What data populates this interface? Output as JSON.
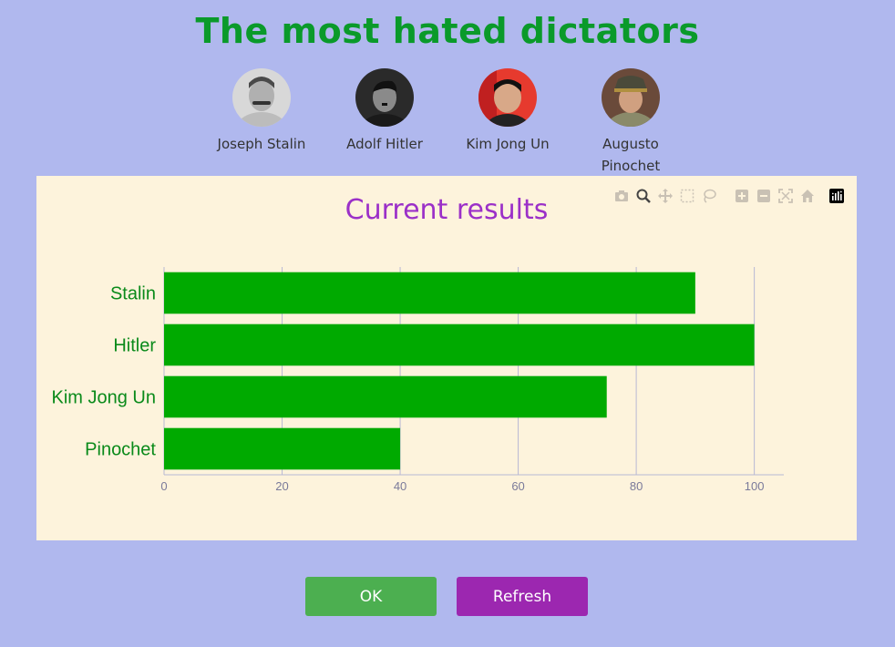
{
  "page": {
    "title": "The most hated dictators"
  },
  "candidates": [
    {
      "name": "Joseph Stalin",
      "icon": "stalin-portrait"
    },
    {
      "name": "Adolf Hitler",
      "icon": "hitler-portrait"
    },
    {
      "name": "Kim Jong Un",
      "icon": "kim-jong-un-portrait"
    },
    {
      "name": "Augusto Pinochet",
      "icon": "pinochet-portrait"
    }
  ],
  "modebar": {
    "icons": [
      "camera-icon",
      "zoom-icon",
      "pan-icon",
      "box-select-icon",
      "lasso-icon",
      "zoom-in-icon",
      "zoom-out-icon",
      "autoscale-icon",
      "reset-axes-icon",
      "plotly-logo-icon"
    ]
  },
  "chart_data": {
    "type": "bar",
    "orientation": "horizontal",
    "title": "Current results",
    "categories": [
      "Stalin",
      "Hitler",
      "Kim Jong Un",
      "Pinochet"
    ],
    "values": [
      90,
      100,
      75,
      40
    ],
    "xticks": [
      "0",
      "20",
      "40",
      "60",
      "80",
      "100"
    ],
    "xlim": [
      0,
      105
    ],
    "grid": true,
    "bar_color": "#00aa00",
    "tick_label_color": "#0a8a1a",
    "title_color": "#9b30c8",
    "background": "#fdf3dc"
  },
  "buttons": {
    "ok_label": "OK",
    "refresh_label": "Refresh"
  },
  "colors": {
    "page_background": "#b0b8ee",
    "title": "#0a9a2a",
    "ok_button": "#4caf50",
    "refresh_button": "#9c27b0"
  }
}
